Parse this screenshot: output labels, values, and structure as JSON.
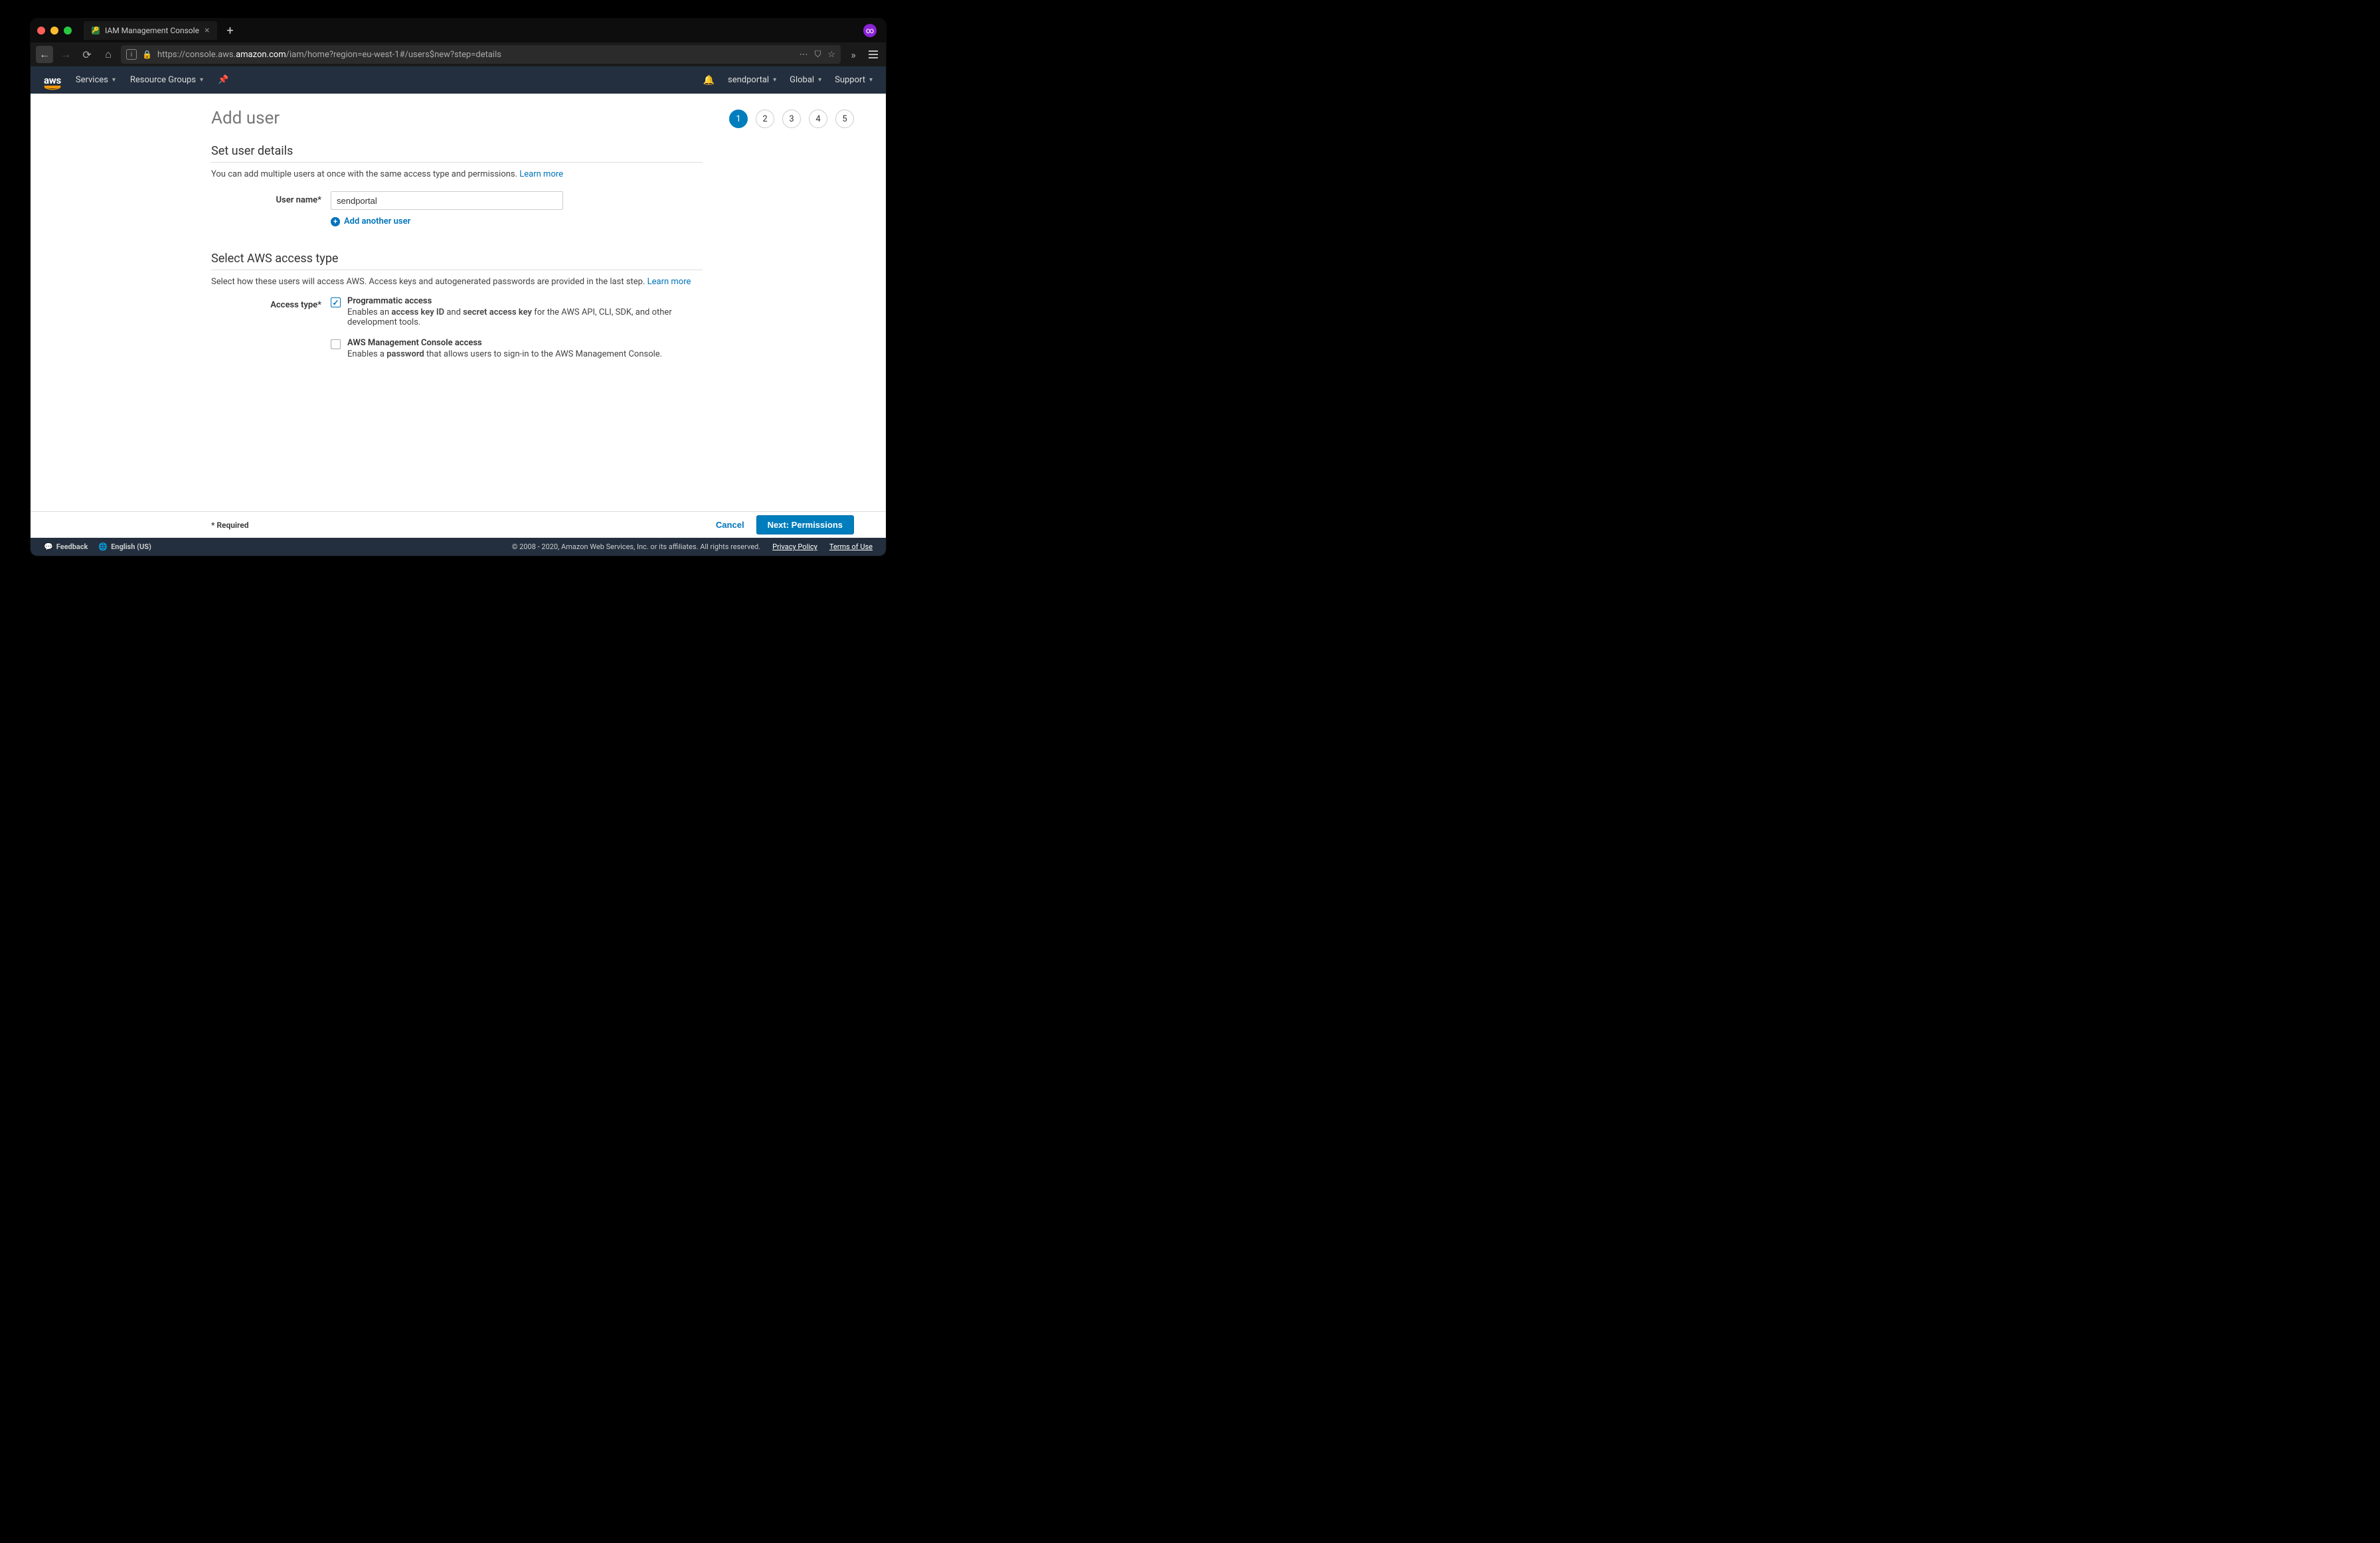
{
  "browser": {
    "tab_title": "IAM Management Console",
    "url_pre": "https://console.aws.",
    "url_host": "amazon.com",
    "url_path": "/iam/home?region=eu-west-1#/users$new?step=details"
  },
  "nav": {
    "logo": "aws",
    "services": "Services",
    "resource_groups": "Resource Groups",
    "account": "sendportal",
    "region": "Global",
    "support": "Support"
  },
  "page": {
    "title": "Add user",
    "steps": [
      "1",
      "2",
      "3",
      "4",
      "5"
    ],
    "active_step": 1
  },
  "section1": {
    "title": "Set user details",
    "desc": "You can add multiple users at once with the same access type and permissions. ",
    "learn_more": "Learn more",
    "user_name_label": "User name*",
    "user_name_value": "sendportal",
    "add_another": "Add another user"
  },
  "section2": {
    "title": "Select AWS access type",
    "desc": "Select how these users will access AWS. Access keys and autogenerated passwords are provided in the last step. ",
    "learn_more": "Learn more",
    "access_type_label": "Access type*",
    "option1": {
      "title": "Programmatic access",
      "desc_pre": "Enables an ",
      "desc_b1": "access key ID",
      "desc_mid": " and ",
      "desc_b2": "secret access key",
      "desc_post": " for the AWS API, CLI, SDK, and other development tools."
    },
    "option2": {
      "title": "AWS Management Console access",
      "desc_pre": "Enables a ",
      "desc_b1": "password",
      "desc_post": " that allows users to sign-in to the AWS Management Console."
    }
  },
  "actions": {
    "required": "* Required",
    "cancel": "Cancel",
    "next": "Next: Permissions"
  },
  "footer": {
    "feedback": "Feedback",
    "language": "English (US)",
    "copyright": "© 2008 - 2020, Amazon Web Services, Inc. or its affiliates. All rights reserved.",
    "privacy": "Privacy Policy",
    "terms": "Terms of Use"
  }
}
